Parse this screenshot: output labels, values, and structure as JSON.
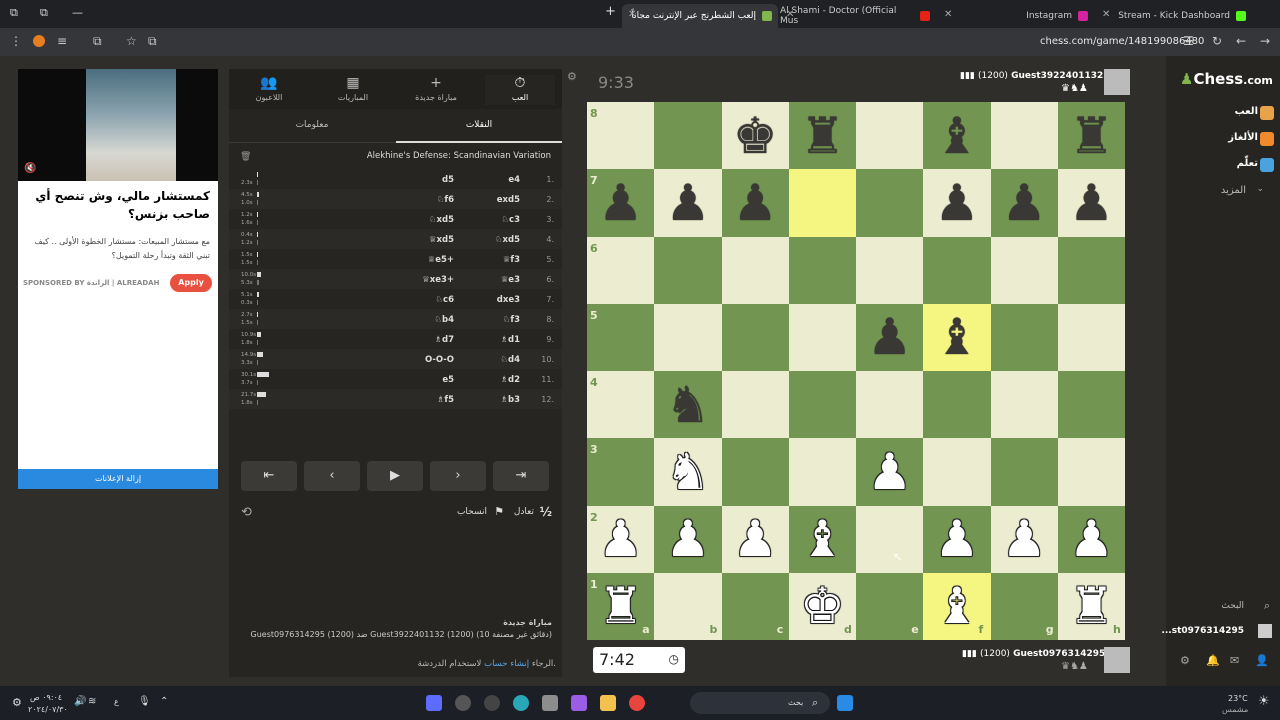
{
  "browser": {
    "tabs": [
      {
        "title": "إلعب الشطرنج عبر الإنترنت مجاناً",
        "active": true
      },
      {
        "title": "Al Shami - Doctor (Official Mus",
        "active": false
      },
      {
        "title": "Instagram",
        "active": false
      },
      {
        "title": "Stream - Kick Dashboard",
        "active": false
      }
    ],
    "new_tab": "+",
    "minimize": "—",
    "url": "chess.com/game/148199086480"
  },
  "ad": {
    "title": "كمستشار مالي، وش تنصح أي صاحب بزنس؟",
    "body": "مع مستشار المبيعات: مستشار الخطوة الأولى .. كيف تبني الثقة وتبدأ رحلة التمويل؟",
    "sponsored": "SPONSORED BY الراندة | ALREADAH",
    "apply": "Apply",
    "remove": "إزالة الإعلانات"
  },
  "panel": {
    "nav": [
      {
        "label": "العب",
        "icon": "⏱"
      },
      {
        "label": "مباراة جديدة",
        "icon": "+"
      },
      {
        "label": "المباريات",
        "icon": "▦"
      },
      {
        "label": "اللاعبون",
        "icon": "👥"
      }
    ],
    "subtabs": [
      "النقلات",
      "معلومات"
    ],
    "opening": "Alekhine's Defense: Scandinavian Variation",
    "moves": [
      {
        "n": "1.",
        "w": "e4",
        "b": "d5",
        "tw": "",
        "tb": "2.3s",
        "tw2": "",
        "tb2": "1.4s"
      },
      {
        "n": "2.",
        "w": "exd5",
        "b": "♘f6",
        "tw": "4.5s",
        "tb": "1.0s"
      },
      {
        "n": "3.",
        "w": "♘c3",
        "b": "♘xd5",
        "tw": "1.2s",
        "tb": "1.6s"
      },
      {
        "n": "4.",
        "w": "♘xd5",
        "b": "♕xd5",
        "tw": "0.4s",
        "tb": "1.2s"
      },
      {
        "n": "5.",
        "w": "♕f3",
        "b": "♕e5+",
        "tw": "1.5s",
        "tb": "1.5s"
      },
      {
        "n": "6.",
        "w": "♕e3",
        "b": "♕xe3+",
        "tw": "10.0s",
        "tb": "5.3s"
      },
      {
        "n": "7.",
        "w": "dxe3",
        "b": "♘c6",
        "tw": "5.1s",
        "tb": "0.3s"
      },
      {
        "n": "8.",
        "w": "♘f3",
        "b": "♘b4",
        "tw": "2.7s",
        "tb": "1.5s"
      },
      {
        "n": "9.",
        "w": "♗d1",
        "b": "♗d7",
        "tw": "10.9s",
        "tb": "1.8s"
      },
      {
        "n": "10.",
        "w": "♘d4",
        "b": "O-O-O",
        "tw": "14.9s",
        "tb": "3.3s"
      },
      {
        "n": "11.",
        "w": "♗d2",
        "b": "e5",
        "tw": "30.1s",
        "tb": "3.7s"
      },
      {
        "n": "12.",
        "w": "♗b3",
        "b": "♗f5",
        "tw": "21.7s",
        "tb": "1.8s"
      }
    ],
    "draw": "تعادل",
    "half": "½",
    "resign": "انسحاب",
    "new_game": "مباراة جديدة",
    "game_line": "Guest0976314295 (1200) ضد Guest3922401132 (1200) (10 دقائق غير مصنفة)",
    "chat_prefix": "الرجاء",
    "chat_link": "إنشاء حساب",
    "chat_suffix": "لاستخدام الدردشة."
  },
  "top_player": {
    "name": "Guest3922401132",
    "rating": "(1200)",
    "clock": "9:33"
  },
  "bottom_player": {
    "name": "Guest0976314295",
    "rating": "(1200)",
    "clock": "7:42"
  },
  "board": {
    "ranks": [
      "8",
      "7",
      "6",
      "5",
      "4",
      "3",
      "2",
      "1"
    ],
    "files": [
      "a",
      "b",
      "c",
      "d",
      "e",
      "f",
      "g",
      "h"
    ],
    "light": "#ebecd0",
    "dark": "#739552",
    "position": [
      [
        "",
        "",
        "bK",
        "bR",
        "",
        "bB",
        "",
        "bR"
      ],
      [
        "bP",
        "bP",
        "bP",
        "",
        "",
        "bP",
        "bP",
        "bP"
      ],
      [
        "",
        "",
        "",
        "",
        "",
        "",
        "",
        ""
      ],
      [
        "",
        "",
        "",
        "",
        "bP",
        "bB",
        "",
        ""
      ],
      [
        "",
        "bN",
        "",
        "",
        "",
        "",
        "",
        ""
      ],
      [
        "",
        "wN",
        "",
        "",
        "wP",
        "",
        "",
        ""
      ],
      [
        "wP",
        "wP",
        "wP",
        "wB",
        "",
        "wP",
        "wP",
        "wP"
      ],
      [
        "wR",
        "",
        "",
        "wK",
        "",
        "wB",
        "",
        "wR"
      ]
    ],
    "highlights": [
      [
        1,
        3
      ],
      [
        3,
        5
      ],
      [
        7,
        5
      ]
    ]
  },
  "right": {
    "logo_a": "Chess",
    "logo_b": ".com",
    "nav": [
      "العب",
      "الألغاز",
      "تعلّم",
      "المزيد"
    ],
    "search": "البحث",
    "user": "...st0976314295"
  },
  "taskbar": {
    "search": "بحث",
    "temp": "23°C",
    "cond": "مشمس",
    "time": "٠٩:٠٤ ص",
    "date": "٢٠٢٤/٠٧/٣٠"
  }
}
